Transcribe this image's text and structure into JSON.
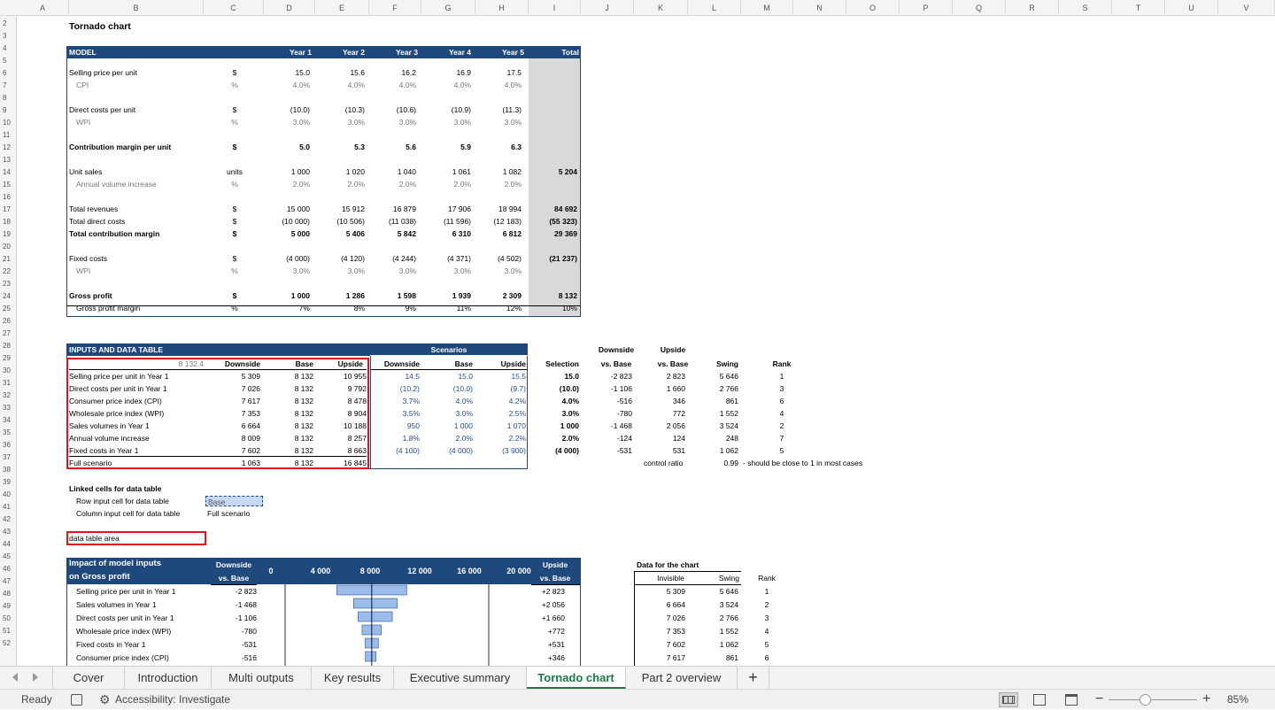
{
  "columns": [
    "A",
    "B",
    "C",
    "D",
    "E",
    "F",
    "G",
    "H",
    "I",
    "J",
    "K",
    "L",
    "M",
    "N",
    "O",
    "P",
    "Q",
    "R",
    "S",
    "T",
    "U",
    "V"
  ],
  "rows": [
    "2",
    "3",
    "4",
    "5",
    "6",
    "7",
    "8",
    "9",
    "10",
    "11",
    "12",
    "13",
    "14",
    "15",
    "16",
    "17",
    "18",
    "19",
    "20",
    "21",
    "22",
    "23",
    "24",
    "25",
    "26",
    "27",
    "28",
    "29",
    "30",
    "31",
    "32",
    "33",
    "34",
    "35",
    "36",
    "37",
    "38",
    "39",
    "40",
    "41",
    "42",
    "43",
    "44",
    "45",
    "46",
    "47",
    "48",
    "49",
    "50",
    "51",
    "52"
  ],
  "title": "Tornado chart",
  "model": {
    "header": {
      "label": "MODEL",
      "years": [
        "Year 1",
        "Year 2",
        "Year 3",
        "Year 4",
        "Year 5"
      ],
      "total": "Total"
    },
    "selling": {
      "label": "Selling price per unit",
      "unit": "$",
      "vals": [
        "15.0",
        "15.6",
        "16.2",
        "16.9",
        "17.5"
      ]
    },
    "cpi": {
      "label": "CPI",
      "unit": "%",
      "vals": [
        "4.0%",
        "4.0%",
        "4.0%",
        "4.0%",
        "4.0%"
      ]
    },
    "direct": {
      "label": "Direct costs per unit",
      "unit": "$",
      "vals": [
        "(10.0)",
        "(10.3)",
        "(10.6)",
        "(10.9)",
        "(11.3)"
      ]
    },
    "wpi1": {
      "label": "WPI",
      "unit": "%",
      "vals": [
        "3.0%",
        "3.0%",
        "3.0%",
        "3.0%",
        "3.0%"
      ]
    },
    "contrib": {
      "label": "Contribution margin per unit",
      "unit": "$",
      "vals": [
        "5.0",
        "5.3",
        "5.6",
        "5.9",
        "6.3"
      ]
    },
    "units": {
      "label": "Unit sales",
      "unit": "units",
      "vals": [
        "1 000",
        "1 020",
        "1 040",
        "1 061",
        "1 082"
      ],
      "total": "5 204"
    },
    "annual": {
      "label": "Annual volume increase",
      "unit": "%",
      "vals": [
        "2.0%",
        "2.0%",
        "2.0%",
        "2.0%",
        "2.0%"
      ]
    },
    "revenues": {
      "label": "Total revenues",
      "unit": "$",
      "vals": [
        "15 000",
        "15 912",
        "16 879",
        "17 906",
        "18 994"
      ],
      "total": "84 692"
    },
    "dcosts": {
      "label": "Total direct costs",
      "unit": "$",
      "vals": [
        "(10 000)",
        "(10 506)",
        "(11 038)",
        "(11 596)",
        "(12 183)"
      ],
      "total": "(55 323)"
    },
    "tcontrib": {
      "label": "Total contribution margin",
      "unit": "$",
      "vals": [
        "5 000",
        "5 406",
        "5 842",
        "6 310",
        "6 812"
      ],
      "total": "29 369"
    },
    "fixed": {
      "label": "Fixed costs",
      "unit": "$",
      "vals": [
        "(4 000)",
        "(4 120)",
        "(4 244)",
        "(4 371)",
        "(4 502)"
      ],
      "total": "(21 237)"
    },
    "wpi2": {
      "label": "WPI",
      "unit": "%",
      "vals": [
        "3.0%",
        "3.0%",
        "3.0%",
        "3.0%",
        "3.0%"
      ]
    },
    "gross": {
      "label": "Gross profit",
      "unit": "$",
      "vals": [
        "1 000",
        "1 286",
        "1 598",
        "1 939",
        "2 309"
      ],
      "total": "8 132"
    },
    "gmargin": {
      "label": "Gross profit margin",
      "unit": "%",
      "vals": [
        "7%",
        "8%",
        "9%",
        "11%",
        "12%"
      ],
      "total": "10%"
    }
  },
  "inputs": {
    "header": "INPUTS AND DATA TABLE",
    "scenarios": "Scenarios",
    "corner": "8 132.4",
    "cols": [
      "Downside",
      "Base",
      "Upside"
    ],
    "scols": [
      "Downside",
      "Base",
      "Upside"
    ],
    "sel": "Selection",
    "dvb1": "Downside",
    "dvb2": "vs. Base",
    "uvb1": "Upside",
    "uvb2": "vs. Base",
    "swing": "Swing",
    "rank": "Rank",
    "rows": [
      {
        "label": "Selling price per unit in Year 1",
        "d": "5 309",
        "b": "8 132",
        "u": "10 955",
        "sd": "14.5",
        "sb": "15.0",
        "su": "15.5",
        "sel": "15.0",
        "dv": "-2 823",
        "uv": "2 823",
        "sw": "5 646",
        "rk": "1"
      },
      {
        "label": "Direct costs per unit in Year 1",
        "d": "7 026",
        "b": "8 132",
        "u": "9 792",
        "sd": "(10.2)",
        "sb": "(10.0)",
        "su": "(9.7)",
        "sel": "(10.0)",
        "dv": "-1 106",
        "uv": "1 660",
        "sw": "2 766",
        "rk": "3"
      },
      {
        "label": "Consumer price index (CPI)",
        "d": "7 617",
        "b": "8 132",
        "u": "8 478",
        "sd": "3.7%",
        "sb": "4.0%",
        "su": "4.2%",
        "sel": "4.0%",
        "dv": "-516",
        "uv": "346",
        "sw": "861",
        "rk": "6"
      },
      {
        "label": "Wholesale price index (WPI)",
        "d": "7 353",
        "b": "8 132",
        "u": "8 904",
        "sd": "3.5%",
        "sb": "3.0%",
        "su": "2.5%",
        "sel": "3.0%",
        "dv": "-780",
        "uv": "772",
        "sw": "1 552",
        "rk": "4"
      },
      {
        "label": "Sales volumes in Year 1",
        "d": "6 664",
        "b": "8 132",
        "u": "10 188",
        "sd": "950",
        "sb": "1 000",
        "su": "1 070",
        "sel": "1 000",
        "dv": "-1 468",
        "uv": "2 056",
        "sw": "3 524",
        "rk": "2"
      },
      {
        "label": "Annual volume increase",
        "d": "8 009",
        "b": "8 132",
        "u": "8 257",
        "sd": "1.8%",
        "sb": "2.0%",
        "su": "2.2%",
        "sel": "2.0%",
        "dv": "-124",
        "uv": "124",
        "sw": "248",
        "rk": "7"
      },
      {
        "label": "Fixed costs in Year 1",
        "d": "7 602",
        "b": "8 132",
        "u": "8 663",
        "sd": "(4 100)",
        "sb": "(4 000)",
        "su": "(3 900)",
        "sel": "(4 000)",
        "dv": "-531",
        "uv": "531",
        "sw": "1 062",
        "rk": "5"
      }
    ],
    "full": {
      "label": "Full scenario",
      "d": "1 063",
      "b": "8 132",
      "u": "16 845"
    },
    "control": "control ratio",
    "controlval": "0.99",
    "controlnote": "- should be close to 1 in most cases"
  },
  "linked": {
    "title": "Linked cells for data table",
    "row": "Row input cell for data table",
    "rowval": "Base",
    "col": "Column input cell for data table",
    "colval": "Full scenario"
  },
  "legend": "data table area",
  "impact": {
    "title1": "Impact of model inputs",
    "title2": "on Gross profit",
    "down1": "Downside",
    "down2": "vs. Base",
    "up1": "Upside",
    "up2": "vs. Base",
    "rows": [
      {
        "label": "Selling price per unit in Year 1",
        "dv": "-2 823",
        "uv": "+2 823"
      },
      {
        "label": "Sales volumes in Year 1",
        "dv": "-1 468",
        "uv": "+2 056"
      },
      {
        "label": "Direct costs per unit in Year 1",
        "dv": "-1 106",
        "uv": "+1 660"
      },
      {
        "label": "Wholesale price index (WPI)",
        "dv": "-780",
        "uv": "+772"
      },
      {
        "label": "Fixed costs in Year 1",
        "dv": "-531",
        "uv": "+531"
      },
      {
        "label": "Consumer price index (CPI)",
        "dv": "-516",
        "uv": "+346"
      }
    ]
  },
  "chart_data": {
    "type": "bar",
    "orientation": "horizontal",
    "axis_ticks": [
      "0",
      "4 000",
      "8 000",
      "12 000",
      "16 000",
      "20 000"
    ],
    "xlim": [
      0,
      22000
    ],
    "base": 8132,
    "categories": [
      "Selling price per unit in Year 1",
      "Sales volumes in Year 1",
      "Direct costs per unit in Year 1",
      "Wholesale price index (WPI)",
      "Fixed costs in Year 1",
      "Consumer price index (CPI)"
    ],
    "downside": [
      5309,
      6664,
      7026,
      7353,
      7602,
      7617
    ],
    "upside": [
      10955,
      10188,
      9792,
      8904,
      8663,
      8478
    ],
    "bar_color": "#9bbbe8"
  },
  "chartdata_tbl": {
    "title": "Data for the chart",
    "h1": "Invisible",
    "h2": "Swing",
    "h3": "Rank",
    "rows": [
      [
        "5 309",
        "5 646",
        "1"
      ],
      [
        "6 664",
        "3 524",
        "2"
      ],
      [
        "7 026",
        "2 766",
        "3"
      ],
      [
        "7 353",
        "1 552",
        "4"
      ],
      [
        "7 602",
        "1 062",
        "5"
      ],
      [
        "7 617",
        "861",
        "6"
      ]
    ]
  },
  "tabs": [
    "Cover",
    "Introduction",
    "Multi outputs",
    "Key results",
    "Executive summary",
    "Tornado chart",
    "Part 2 overview"
  ],
  "active_tab": "Tornado chart",
  "status": {
    "ready": "Ready",
    "access": "Accessibility: Investigate",
    "zoom": "85%"
  },
  "colors": {
    "header": "#1f497d",
    "total": "#d9d9d9",
    "red": "#e0141a",
    "accent": "#1e7a45"
  }
}
